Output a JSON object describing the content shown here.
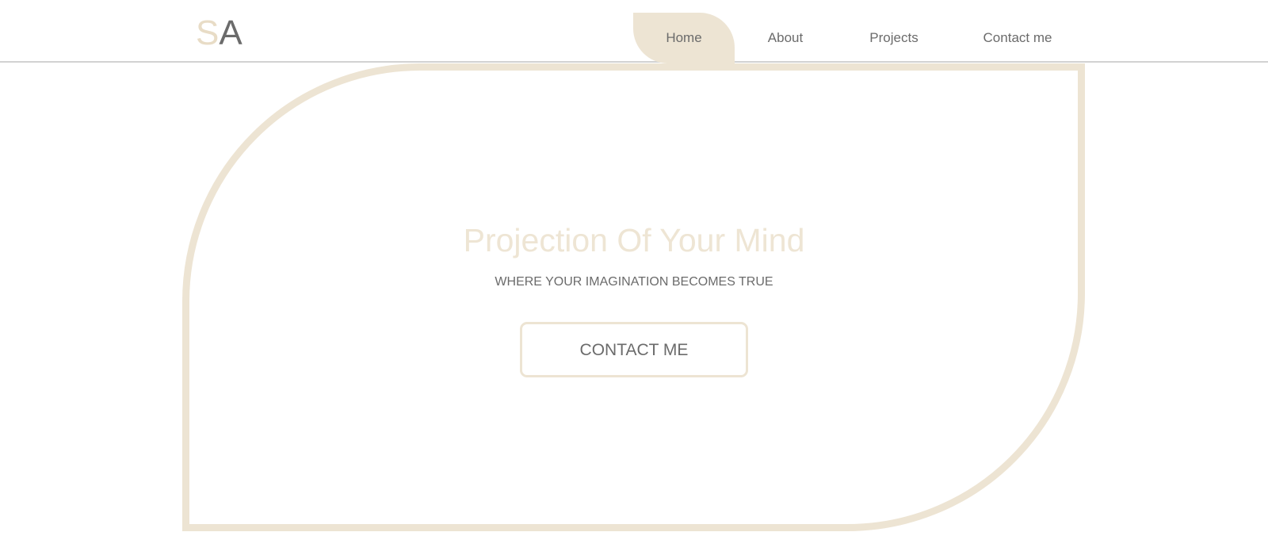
{
  "logo": {
    "first": "S",
    "second": "A"
  },
  "nav": {
    "items": [
      {
        "label": "Home",
        "active": true
      },
      {
        "label": "About",
        "active": false
      },
      {
        "label": "Projects",
        "active": false
      },
      {
        "label": "Contact me",
        "active": false
      }
    ]
  },
  "hero": {
    "title": "Projection Of Your Mind",
    "subtitle": "WHERE YOUR IMAGINATION BECOMES TRUE",
    "cta_label": "CONTACT ME"
  },
  "colors": {
    "accent": "#ede4d3",
    "text": "#6b6b6b",
    "title": "#eee5d4",
    "divider": "#d2d2d2"
  }
}
